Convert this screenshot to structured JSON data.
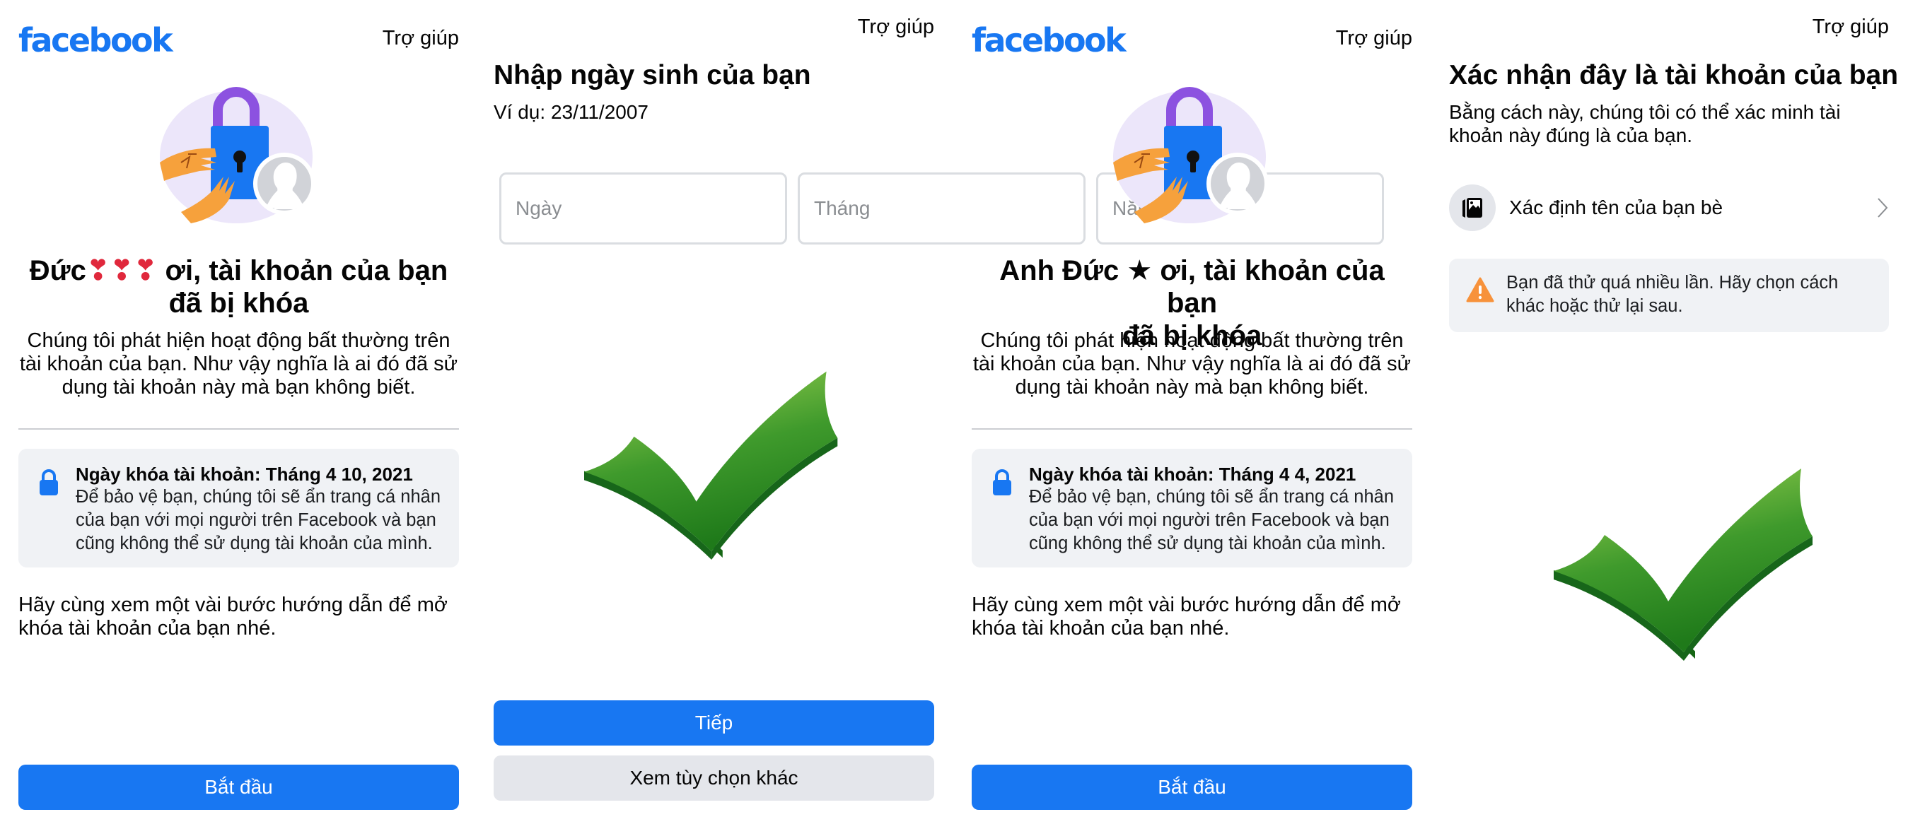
{
  "colors": {
    "brand": "#1877f2",
    "secondary_button": "#e4e6eb",
    "info_box": "#f0f2f5",
    "warning": "#f7923b",
    "check_light": "#9ccf4e",
    "check_dark": "#1e7a1a"
  },
  "panels": [
    {
      "logo": "facebook",
      "help": "Trợ giúp",
      "illustration": "locked-account-illustration",
      "title_line1": "Đức❣❣❣ ơi, tài khoản của bạn",
      "title_line2": "đã bị khóa",
      "body": "Chúng tôi phát hiện hoạt động bất thường trên tài khoản của bạn. Như vậy nghĩa là ai đó đã sử dụng tài khoản này mà bạn không biết.",
      "info_icon": "lock-icon",
      "info_title": "Ngày khóa tài khoản: Tháng 4 10, 2021",
      "info_text": "Để bảo vệ bạn, chúng tôi sẽ ẩn trang cá nhân của bạn với mọi người trên Facebook và bạn cũng không thể sử dụng tài khoản của mình.",
      "guide": "Hãy cùng xem một vài bước hướng dẫn để mở khóa tài khoản của bạn nhé.",
      "button": "Bắt đầu"
    },
    {
      "help": "Trợ giúp",
      "title": "Nhập ngày sinh của bạn",
      "example": "Ví dụ: 23/11/2007",
      "inputs": [
        {
          "placeholder": "Ngày",
          "value": ""
        },
        {
          "placeholder": "Tháng",
          "value": ""
        },
        {
          "placeholder": "Năm",
          "value": ""
        }
      ],
      "overlay_icon": "green-checkmark-icon",
      "primary_button": "Tiếp",
      "secondary_button": "Xem tùy chọn khác"
    },
    {
      "logo": "facebook",
      "help": "Trợ giúp",
      "illustration": "locked-account-illustration",
      "title_line1": "Anh Đức ★ ơi, tài khoản của bạn",
      "title_line2": "đã bị khóa",
      "body": "Chúng tôi phát hiện hoạt động bất thường trên tài khoản của bạn. Như vậy nghĩa là ai đó đã sử dụng tài khoản này mà bạn không biết.",
      "info_icon": "lock-icon",
      "info_title": "Ngày khóa tài khoản: Tháng 4 4, 2021",
      "info_text": "Để bảo vệ bạn, chúng tôi sẽ ẩn trang cá nhân của bạn với mọi người trên Facebook và bạn cũng không thể sử dụng tài khoản của mình.",
      "guide": "Hãy cùng xem một vài bước hướng dẫn để mở khóa tài khoản của bạn nhé.",
      "button": "Bắt đầu"
    },
    {
      "help": "Trợ giúp",
      "title": "Xác nhận đây là tài khoản của bạn",
      "subtitle": "Bằng cách này, chúng tôi có thể xác minh tài khoản này đúng là của bạn.",
      "options": [
        {
          "icon": "photos-icon",
          "label": "Xác định tên của bạn bè",
          "chevron": "chevron-right-icon"
        }
      ],
      "warning_icon": "warning-icon",
      "warning": "Bạn đã thử quá nhiều lần. Hãy chọn cách khác hoặc thử lại sau.",
      "overlay_icon": "green-checkmark-icon"
    }
  ]
}
